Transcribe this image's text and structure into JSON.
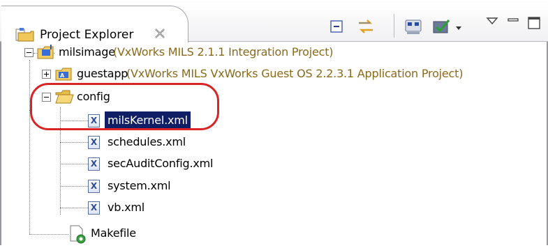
{
  "view": {
    "title": "Project Explorer",
    "close_icon": "close-icon",
    "toolbar_icons": [
      "collapse-all-icon",
      "link-with-editor-icon",
      "connect-target-icon",
      "build-check-icon",
      "dropdown-arrow-icon",
      "view-menu-icon",
      "minimize-icon",
      "maximize-icon"
    ]
  },
  "tree": {
    "root": {
      "name": "milsimage",
      "decoration": "(VxWorks MILS 2.1.1 Integration Project)"
    },
    "guestapp": {
      "name": "guestapp",
      "decoration": "(VxWorks MILS VxWorks Guest OS 2.2.3.1 Application Project)"
    },
    "config_folder": "config",
    "files": [
      {
        "name": "milsKernel.xml",
        "selected": true
      },
      {
        "name": "schedules.xml",
        "selected": false
      },
      {
        "name": "secAuditConfig.xml",
        "selected": false
      },
      {
        "name": "system.xml",
        "selected": false
      },
      {
        "name": "vb.xml",
        "selected": false
      }
    ],
    "makefile": "Makefile",
    "file_icon_letter": "X"
  },
  "colors": {
    "selection": "#101e66",
    "highlight_ring": "#d82424",
    "decoration_text": "#8a6a1a"
  }
}
